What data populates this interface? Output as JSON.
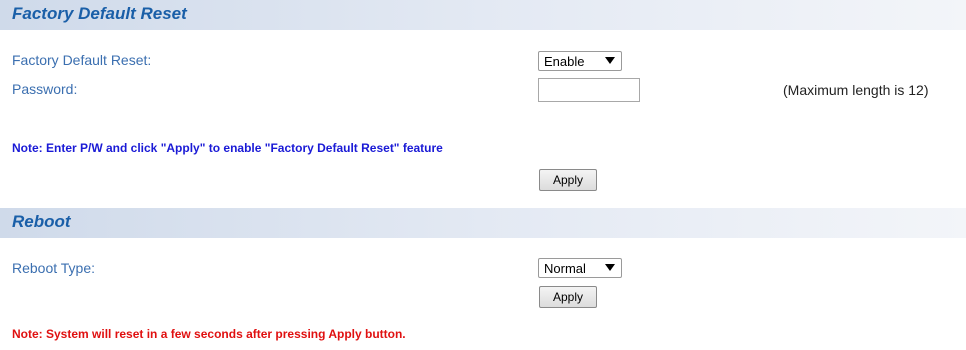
{
  "factory_reset": {
    "section_title": "Factory Default Reset",
    "reset_label": "Factory Default Reset:",
    "reset_value": "Enable",
    "password_label": "Password:",
    "password_value": "",
    "password_hint": "(Maximum length is 12)",
    "note": "Note: Enter P/W and click \"Apply\" to enable \"Factory Default Reset\" feature",
    "note_color": "#1a1ad6",
    "apply_label": "Apply"
  },
  "reboot": {
    "section_title": "Reboot",
    "type_label": "Reboot Type:",
    "type_value": "Normal",
    "apply_label": "Apply",
    "note": "Note: System will reset in a few seconds after pressing Apply button.",
    "note_color": "#e01010"
  },
  "colors": {
    "header_title": "#1a5fa8",
    "label": "#3b6fb0"
  }
}
